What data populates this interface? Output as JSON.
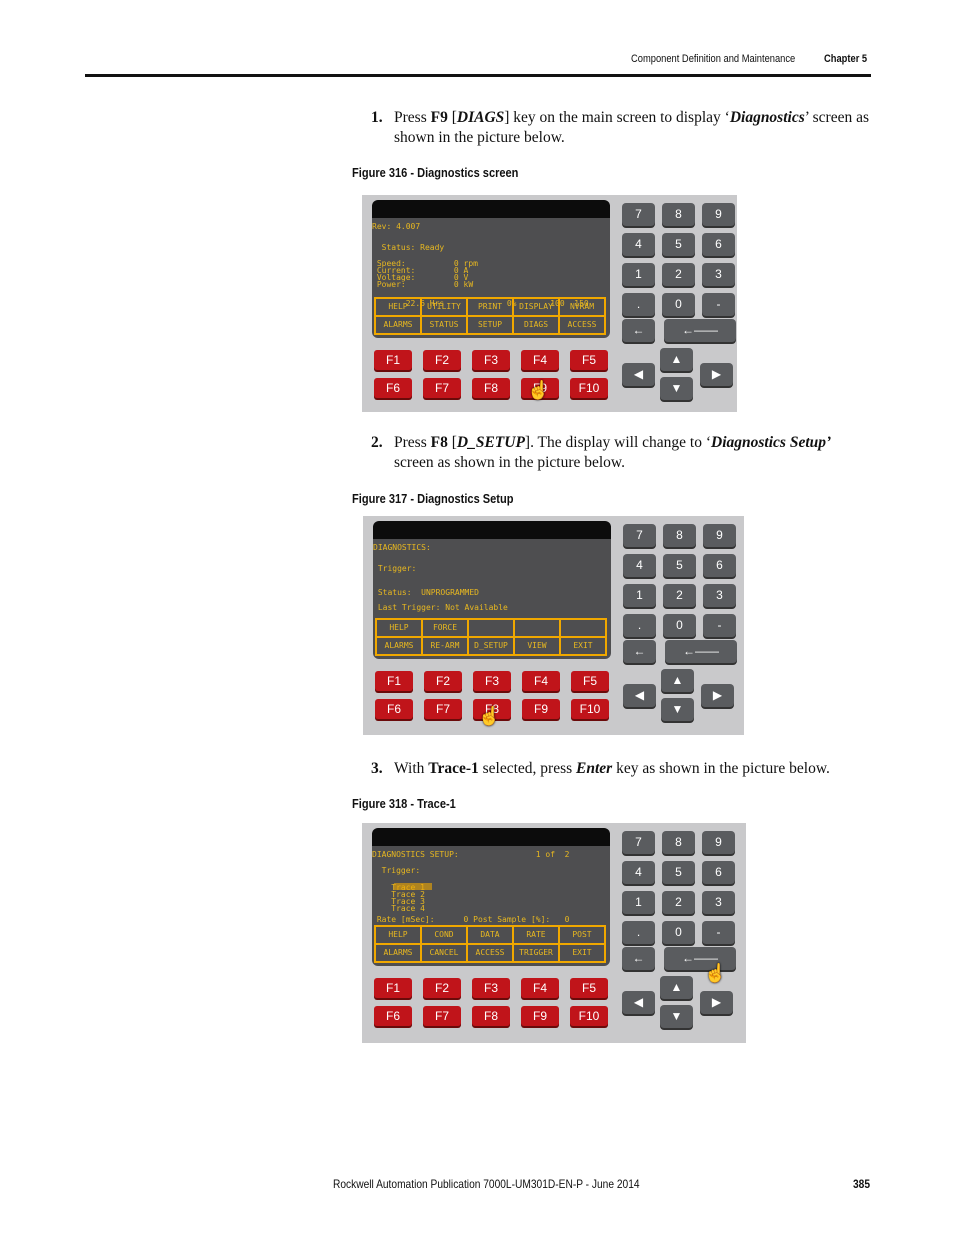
{
  "header": {
    "section": "Component Definition and Maintenance",
    "chapter": "Chapter 5"
  },
  "steps": [
    {
      "num": "1.",
      "html": "Press <b>F9</b> [<b><i>DIAGS</i></b>] key on the main screen to display ‘<b><i>Diagnostics</i></b>’ screen as shown in the picture below."
    },
    {
      "num": "2.",
      "html": "Press <b>F8</b> [<b><i>D_SETUP</i></b>]. The display will change to ‘<b><i>Diagnostics Setup’</i></b> screen as shown in the picture below."
    },
    {
      "num": "3.",
      "html": "With <b>Trace-1</b> selected, press <b><i>Enter</i></b> key as shown in the picture below."
    }
  ],
  "figures": [
    {
      "caption": "Figure 316 - Diagnostics screen",
      "screen_lines": [
        "Rev: 4.007",
        "  Status: Ready",
        " Speed:          0 rpm\n Current:        0 A\n Voltage:        0 V\n Power:          0 kW",
        "       22.6 Hrs             0%       100  150"
      ],
      "softkeys": [
        "HELP",
        "UTILITY",
        "PRINT",
        "DISPLAY",
        "NVRAM",
        "ALARMS",
        "STATUS",
        "SETUP",
        "DIAGS",
        "ACCESS"
      ],
      "pressed": "F9"
    },
    {
      "caption": "Figure 317 - Diagnostics Setup",
      "screen_lines": [
        "DIAGNOSTICS:",
        " Trigger:",
        " Status:  UNPROGRAMMED",
        " Last Trigger: Not Available"
      ],
      "softkeys": [
        "HELP",
        "FORCE",
        "",
        "",
        "",
        "ALARMS",
        "RE-ARM",
        "D_SETUP",
        "VIEW",
        "EXIT"
      ],
      "pressed": "F8"
    },
    {
      "caption": "Figure 318 - Trace-1",
      "screen_lines": [
        "DIAGNOSTICS SETUP:                1 of  2",
        "  Trigger:",
        "    Trace 1\n    Trace 2\n    Trace 3\n    Trace 4",
        " Rate [mSec]:      0 Post Sample [%]:   0"
      ],
      "softkeys": [
        "HELP",
        "COND",
        "DATA",
        "RATE",
        "POST",
        "ALARMS",
        "CANCEL",
        "ACCESS",
        "TRIGGER",
        "EXIT"
      ],
      "pressed": "Enter"
    }
  ],
  "fkeys": [
    "F1",
    "F2",
    "F3",
    "F4",
    "F5",
    "F6",
    "F7",
    "F8",
    "F9",
    "F10"
  ],
  "numkeys": [
    "7",
    "8",
    "9",
    "4",
    "5",
    "6",
    "1",
    "2",
    "3",
    ".",
    "0",
    "-"
  ],
  "arrows": {
    "back": "←",
    "enter": "←——",
    "up": "▲",
    "down": "▼",
    "left": "◀",
    "right": "▶"
  },
  "colors": {
    "screen_text": "#e8b820",
    "fkey": "#c0141a",
    "keypad": "#5a5c5f"
  },
  "footer": {
    "publication": "Rockwell Automation Publication 7000L-UM301D-EN-P - June 2014",
    "page": "385"
  }
}
